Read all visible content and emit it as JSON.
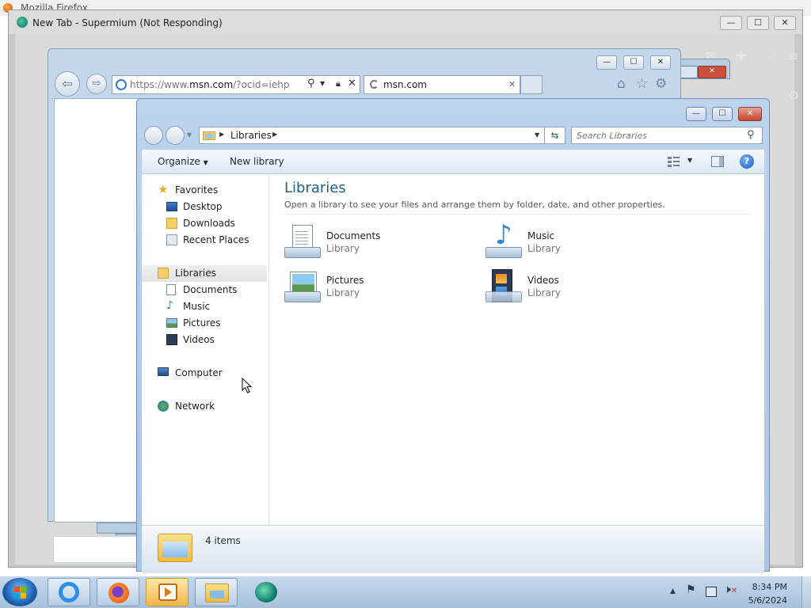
{
  "firefox": {
    "title": "Mozilla Firefox"
  },
  "supermium": {
    "title": "New Tab - Supermium (Not Responding)",
    "controls": {
      "minimize": "—",
      "maximize": "☐",
      "close": "✕"
    }
  },
  "ie": {
    "address": {
      "prefix": "https://www.",
      "domain": "msn.com",
      "suffix": "/?ocid=iehp"
    },
    "tab": {
      "title": "msn.com",
      "close": "✕"
    },
    "controls": {
      "minimize": "—",
      "maximize": "☐",
      "close": "✕"
    }
  },
  "explorer": {
    "controls": {
      "minimize": "—",
      "maximize": "☐",
      "close": "✕"
    },
    "address": {
      "crumbs": [
        "Libraries"
      ]
    },
    "search": {
      "placeholder": "Search Libraries"
    },
    "toolbar": {
      "organize": "Organize",
      "new_library": "New library"
    },
    "nav": {
      "favorites": {
        "label": "Favorites",
        "items": [
          "Desktop",
          "Downloads",
          "Recent Places"
        ]
      },
      "libraries": {
        "label": "Libraries",
        "items": [
          "Documents",
          "Music",
          "Pictures",
          "Videos"
        ]
      },
      "computer": "Computer",
      "network": "Network"
    },
    "main": {
      "title": "Libraries",
      "subtitle": "Open a library to see your files and arrange them by folder, date, and other properties.",
      "libraries": [
        {
          "name": "Documents",
          "type": "Library",
          "icon": "documents-library-icon"
        },
        {
          "name": "Music",
          "type": "Library",
          "icon": "music-library-icon"
        },
        {
          "name": "Pictures",
          "type": "Library",
          "icon": "pictures-library-icon"
        },
        {
          "name": "Videos",
          "type": "Library",
          "icon": "videos-library-icon"
        }
      ]
    },
    "status": {
      "count": "4 items"
    }
  },
  "taskbar": {
    "time": "8:34 PM",
    "date": "5/6/2024",
    "pinned": [
      "internet-explorer-icon",
      "firefox-icon",
      "media-player-icon",
      "explorer-icon",
      "supermium-icon"
    ]
  },
  "colors": {
    "heading": "#1e5f8c",
    "accent": "#3a6ea5"
  }
}
